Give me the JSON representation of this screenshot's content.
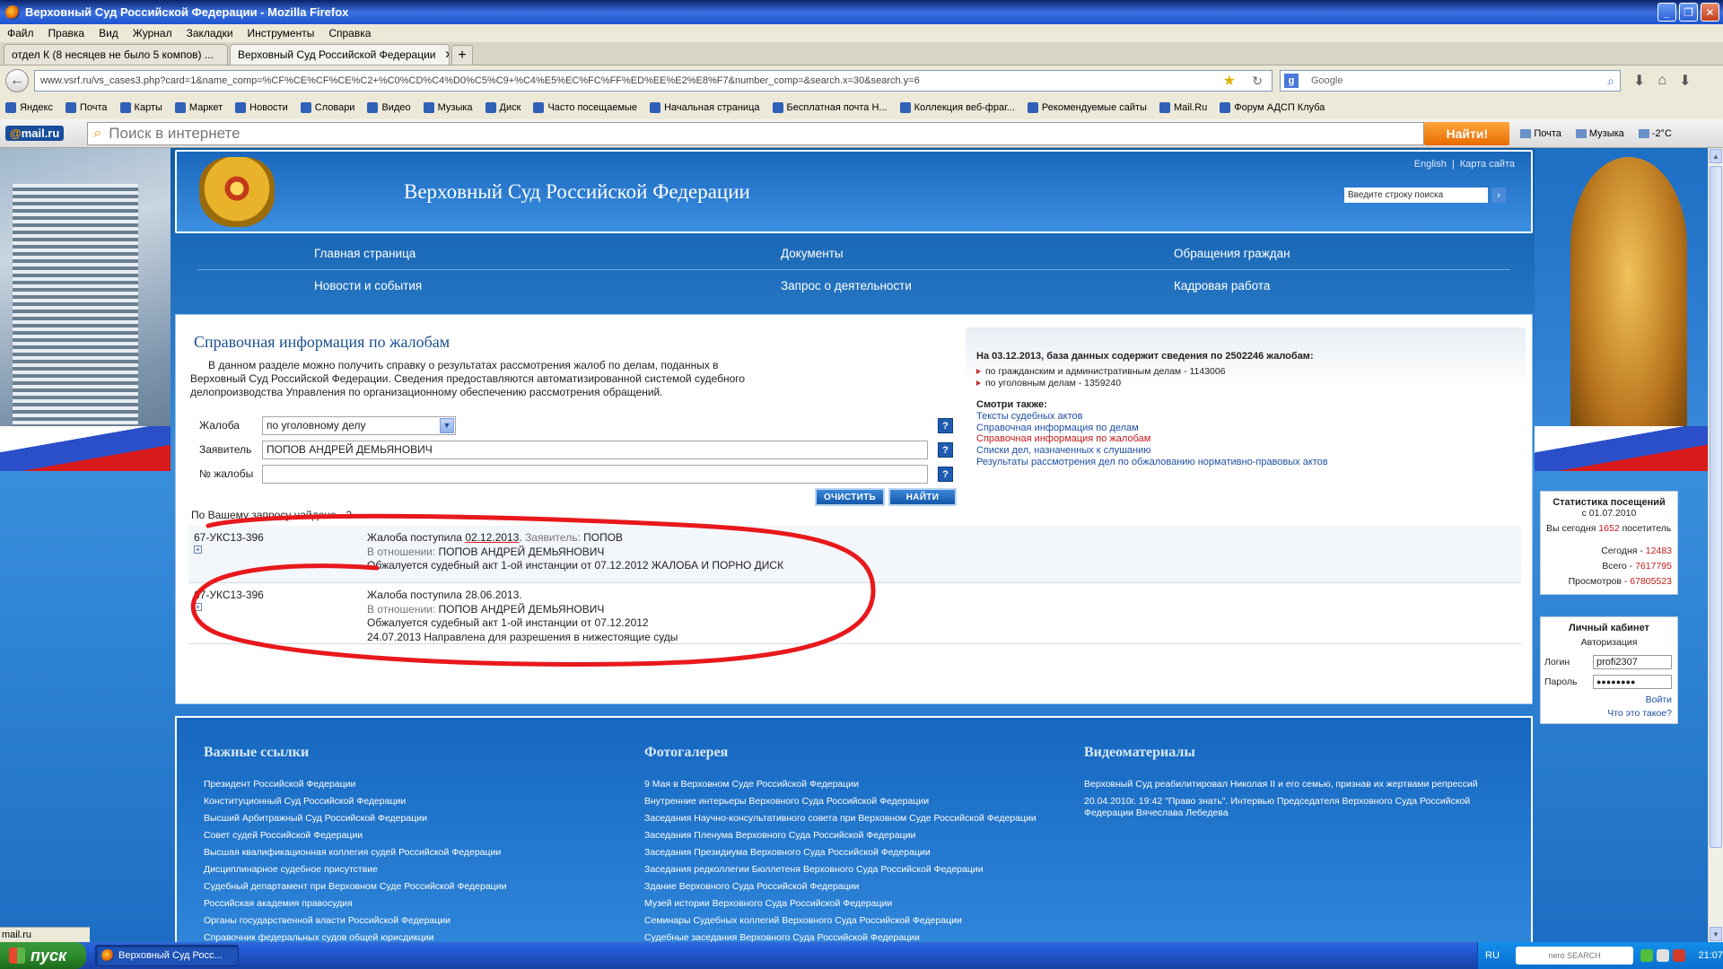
{
  "window": {
    "title": "Верховный Суд Российской Федерации - Mozilla Firefox"
  },
  "menu": [
    "Файл",
    "Правка",
    "Вид",
    "Журнал",
    "Закладки",
    "Инструменты",
    "Справка"
  ],
  "tabs": [
    {
      "label": "отдел К (8 несяцев не было 5 компов) ...",
      "active": false
    },
    {
      "label": "Верховный Суд Российской Федерации",
      "active": true
    }
  ],
  "navbar": {
    "url": "www.vsrf.ru/vs_cases3.php?card=1&name_comp=%CF%CE%CF%CE%C2+%C0%CD%C4%D0%C5%C9+%C4%E5%EC%FC%FF%ED%EE%E2%E8%F7&number_comp=&search.x=30&search.y=6",
    "search_placeholder": "Google"
  },
  "bookmarks": [
    "Яндекс",
    "Почта",
    "Карты",
    "Маркет",
    "Новости",
    "Словари",
    "Видео",
    "Музыка",
    "Диск",
    "Часто посещаемые",
    "Начальная страница",
    "Бесплатная почта Н...",
    "Коллекция веб-фраг...",
    "Рекомендуемые сайты",
    "Mail.Ru",
    "Форум АДСП Клуба"
  ],
  "mailru": {
    "logo_at": "@",
    "logo_text": "mail.ru",
    "search_placeholder": "Поиск в интернете",
    "button": "Найти!",
    "extras": [
      "Почта",
      "Музыка",
      "-2°C"
    ]
  },
  "site": {
    "title": "Верховный Суд Российской Федерации",
    "lang_link": "English",
    "sitemap_link": "Карта сайта",
    "search_placeholder": "Введите строку поиска",
    "nav": {
      "row1": [
        "Главная страница",
        "Документы",
        "Обращения граждан"
      ],
      "row2": [
        "Новости и события",
        "Запрос о деятельности",
        "Кадровая работа"
      ]
    }
  },
  "content": {
    "title": "Справочная информация по жалобам",
    "description": "В данном разделе можно получить справку о результатах рассмотрения жалоб по делам, поданных в Верховный Суд Российской Федерации. Сведения предоставляются автоматизированной системой судебного делопроизводства Управления по организационному обеспечению рассмотрения обращений.",
    "form": {
      "complaint_label": "Жалоба",
      "complaint_value": "по уголовному делу",
      "applicant_label": "Заявитель",
      "applicant_value": "ПОПОВ АНДРЕЙ ДЕМЬЯНОВИЧ",
      "number_label": "№ жалобы",
      "number_value": "",
      "help": "?",
      "clear_button": "ОЧИСТИТЬ",
      "find_button": "НАЙТИ"
    },
    "found": "По Вашему запросу найдено - 2",
    "results": [
      {
        "number": "67-УКС13-396",
        "line1_pre": "Жалоба поступила ",
        "date": "02.12.2013",
        "line1_post": ". ",
        "applicant_label": "Заявитель:",
        "applicant": " ПОПОВ",
        "regard_label": "В отношении:",
        "regard": " ПОПОВ АНДРЕЙ ДЕМЬЯНОВИЧ",
        "line3": "Обжалуется судебный акт 1-ой инстанции от 07.12.2012 ЖАЛОБА И ПОРНО ДИСК",
        "line4": ""
      },
      {
        "number": "67-УКС13-396",
        "line1_pre": "Жалоба поступила ",
        "date": "28.06.2013",
        "line1_post": ".",
        "applicant_label": "",
        "applicant": "",
        "regard_label": "В отношении:",
        "regard": " ПОПОВ АНДРЕЙ ДЕМЬЯНОВИЧ",
        "line3": "Обжалуется судебный акт 1-ой инстанции от 07.12.2012",
        "line4": "24.07.2013 Направлена для разрешения в нижестоящие суды"
      }
    ]
  },
  "infobox": {
    "header": "На 03.12.2013, база данных содержит сведения по 2502246 жалобам:",
    "items": [
      "по гражданским и административным делам - 1143006",
      "по уголовным делам - 1359240"
    ],
    "see_also": "Смотри также:",
    "links": [
      "Тексты судебных актов",
      "Справочная информация по делам",
      "Справочная информация по жалобам",
      "Списки дел, назначенных к слушанию",
      "Результаты рассмотрения дел по обжалованию нормативно-правовых актов"
    ]
  },
  "stats": {
    "title": "Статистика посещений",
    "since": "с 01.07.2010",
    "today_pre": "Вы сегодня ",
    "today_num": "1652",
    "today_post": " посетитель",
    "rows": [
      {
        "label": "Сегодня - ",
        "value": "12483"
      },
      {
        "label": "Всего - ",
        "value": "7617795"
      },
      {
        "label": "Просмотров - ",
        "value": "67805523"
      }
    ]
  },
  "login": {
    "title": "Личный кабинет",
    "subtitle": "Авторизация",
    "login_label": "Логин",
    "login_value": "profi2307",
    "password_label": "Пароль",
    "password_value": "●●●●●●●●",
    "enter": "Войти",
    "what": "Что это такое?"
  },
  "footer": {
    "links_title": "Важные ссылки",
    "links": [
      "Президент Российской Федерации",
      "Конституционный Суд Российской Федерации",
      "Высший Арбитражный Суд Российской Федерации",
      "Совет судей Российской Федерации",
      "Высшая квалификационная коллегия судей Российской Федерации",
      "Дисциплинарное судебное присутствие",
      "Судебный департамент при Верховном Суде Российской Федерации",
      "Российская академия правосудия",
      "Органы государственной власти Российской Федерации",
      "Справочник федеральных судов общей юрисдикции"
    ],
    "photo_title": "Фотогалерея",
    "photos": [
      "9 Мая в Верховном Суде Российской Федерации",
      "Внутренние интерьеры Верховного Суда Российской Федерации",
      "Заседания Научно-консультативного совета при Верховном Суде Российской Федерации",
      "Заседания Пленума Верховного Суда Российской Федерации",
      "Заседания Президиума Верховного Суда Российской Федерации",
      "Заседания редколлегии Бюллетеня Верховного Суда Российской Федерации",
      "Здание Верховного Суда Российской Федерации",
      "Музей истории Верховного Суда Российской Федерации",
      "Семинары Судебных коллегий Верховного Суда Российской Федерации",
      "Судебные заседания Верховного Суда Российской Федерации"
    ],
    "video_title": "Видеоматериалы",
    "videos": [
      "Верховный Суд реабилитировал Николая II и его семью, признав их жертвами репрессий",
      "20.04.2010г. 19:42 \"Право знать\". Интервью Председателя Верховного Суда Российской",
      "Федерации Вячеслава Лебедева"
    ]
  },
  "statusbar": {
    "text": "mail.ru"
  },
  "taskbar": {
    "start": "пуск",
    "task": "Верховный Суд Росс...",
    "lang": "RU",
    "nero": "nero SEARCH",
    "clock": "21:07"
  },
  "colors": {
    "accent": "#1a68bd",
    "annotation": "#e8181c",
    "link": "#1f4fa3",
    "alert": "#c41a1a"
  }
}
